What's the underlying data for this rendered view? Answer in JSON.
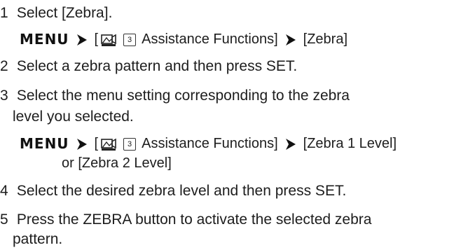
{
  "steps": [
    {
      "number": "1",
      "text": "Select [Zebra]."
    },
    {
      "number": "2",
      "text": "Select a zebra pattern and then press SET."
    },
    {
      "number": "3",
      "text": "Select the menu setting corresponding to the zebra",
      "continuation": "level you selected."
    },
    {
      "number": "4",
      "text": "Select the desired zebra level and then press SET."
    },
    {
      "number": "5",
      "text": "Press the ZEBRA button to activate the selected zebra",
      "continuation": "pattern."
    }
  ],
  "menu_paths": {
    "first": {
      "menu_label": "MENU",
      "open_bracket": "[",
      "page_number": "3",
      "submenu": "Assistance Functions]",
      "target": "[Zebra]",
      "icon": "camera-record-icon"
    },
    "second": {
      "menu_label": "MENU",
      "open_bracket": "[",
      "page_number": "3",
      "submenu": "Assistance Functions]",
      "target": "[Zebra 1 Level]",
      "alternative": "or [Zebra 2 Level]",
      "icon": "camera-record-icon"
    }
  }
}
